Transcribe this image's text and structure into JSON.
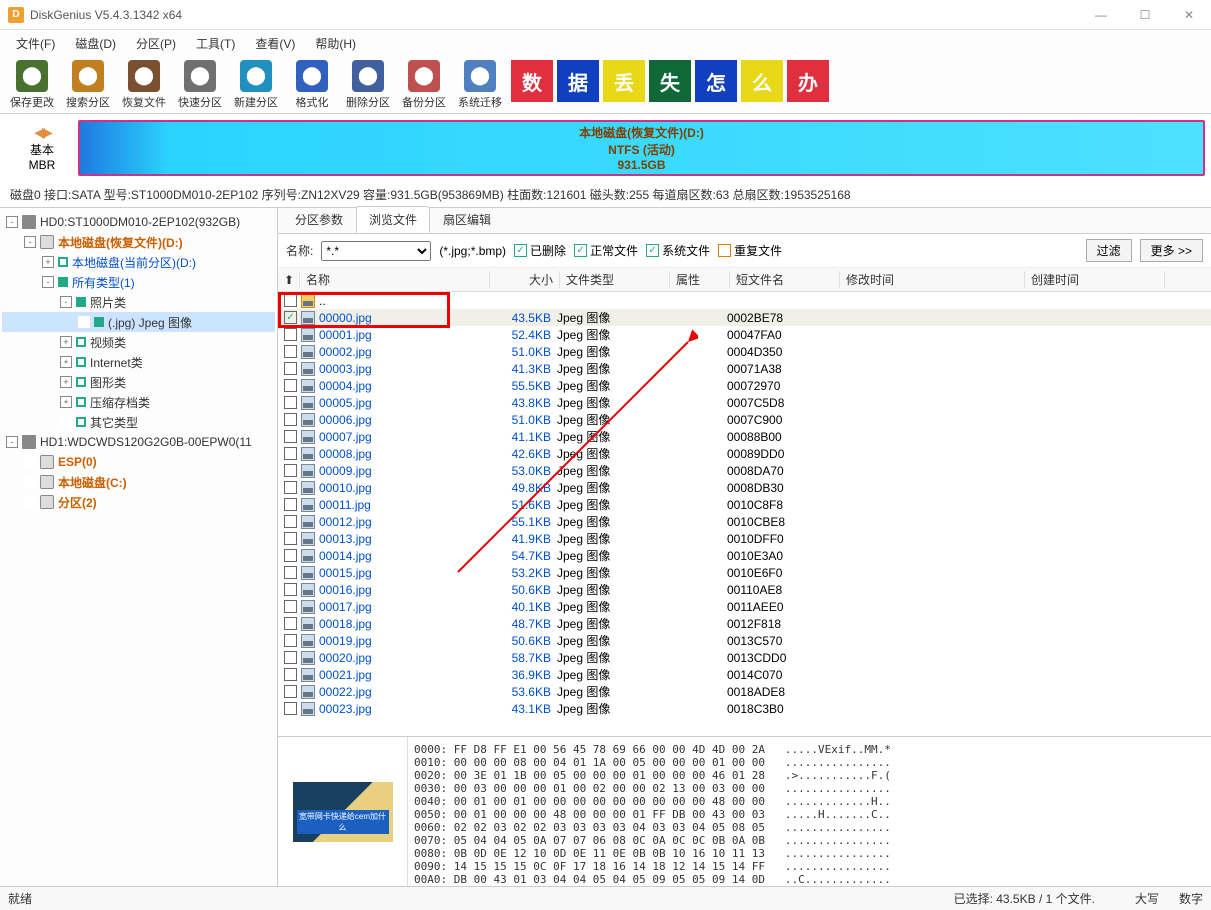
{
  "title": "DiskGenius V5.4.3.1342 x64",
  "menu": [
    "文件(F)",
    "磁盘(D)",
    "分区(P)",
    "工具(T)",
    "查看(V)",
    "帮助(H)"
  ],
  "toolbar": [
    {
      "label": "保存更改",
      "color": "#4a7030"
    },
    {
      "label": "搜索分区",
      "color": "#c08020"
    },
    {
      "label": "恢复文件",
      "color": "#7a5030"
    },
    {
      "label": "快速分区",
      "color": "#707070"
    },
    {
      "label": "新建分区",
      "color": "#2090c0"
    },
    {
      "label": "格式化",
      "color": "#3060c0"
    },
    {
      "label": "删除分区",
      "color": "#4060a0"
    },
    {
      "label": "备份分区",
      "color": "#c05050"
    },
    {
      "label": "系统迁移",
      "color": "#5080c0"
    }
  ],
  "banner": [
    {
      "t": "数",
      "c": "#e03040"
    },
    {
      "t": "据",
      "c": "#1040c0"
    },
    {
      "t": "丢",
      "c": "#e8d818"
    },
    {
      "t": "失",
      "c": "#106838"
    },
    {
      "t": "怎",
      "c": "#1040c0"
    },
    {
      "t": "么",
      "c": "#e8d818"
    },
    {
      "t": "办",
      "c": "#e03040"
    }
  ],
  "mbr_basic": "基本",
  "mbr_mbr": "MBR",
  "partition": {
    "line1": "本地磁盘(恢复文件)(D:)",
    "line2": "NTFS (活动)",
    "line3": "931.5GB"
  },
  "disk_info": "磁盘0 接口:SATA  型号:ST1000DM010-2EP102  序列号:ZN12XV29  容量:931.5GB(953869MB)  柱面数:121601  磁头数:255  每道扇区数:63  总扇区数:1953525168",
  "tree": [
    {
      "indent": 0,
      "twist": "-",
      "ico": "hdd",
      "label": "HD0:ST1000DM010-2EP102(932GB)",
      "cls": ""
    },
    {
      "indent": 1,
      "twist": "-",
      "ico": "disk",
      "label": "本地磁盘(恢复文件)(D:)",
      "cls": "orange"
    },
    {
      "indent": 2,
      "twist": "+",
      "ico": "sq-g",
      "label": "本地磁盘(当前分区)(D:)",
      "cls": "blue"
    },
    {
      "indent": 2,
      "twist": "-",
      "ico": "sq-gf",
      "label": "所有类型(1)",
      "cls": "blue"
    },
    {
      "indent": 3,
      "twist": "-",
      "ico": "sq-gf",
      "label": "照片类",
      "cls": ""
    },
    {
      "indent": 4,
      "twist": "",
      "ico": "sq-gf",
      "label": "(.jpg) Jpeg 图像",
      "cls": "",
      "sel": true
    },
    {
      "indent": 3,
      "twist": "+",
      "ico": "sq-g",
      "label": "视频类",
      "cls": ""
    },
    {
      "indent": 3,
      "twist": "+",
      "ico": "sq-g",
      "label": "Internet类",
      "cls": ""
    },
    {
      "indent": 3,
      "twist": "+",
      "ico": "sq-g",
      "label": "图形类",
      "cls": ""
    },
    {
      "indent": 3,
      "twist": "+",
      "ico": "sq-g",
      "label": "压缩存档类",
      "cls": ""
    },
    {
      "indent": 3,
      "twist": "",
      "ico": "sq-g",
      "label": "其它类型",
      "cls": ""
    },
    {
      "indent": 0,
      "twist": "-",
      "ico": "hdd",
      "label": "HD1:WDCWDS120G2G0B-00EPW0(11",
      "cls": ""
    },
    {
      "indent": 1,
      "twist": "",
      "ico": "disk",
      "label": "ESP(0)",
      "cls": "orange"
    },
    {
      "indent": 1,
      "twist": "",
      "ico": "disk",
      "label": "本地磁盘(C:)",
      "cls": "orange"
    },
    {
      "indent": 1,
      "twist": "",
      "ico": "disk",
      "label": "分区(2)",
      "cls": "orange"
    }
  ],
  "tabs": [
    "分区参数",
    "浏览文件",
    "扇区编辑"
  ],
  "active_tab": 1,
  "filter": {
    "name_label": "名称:",
    "name_value": "*.*",
    "ext_hint": "(*.jpg;*.bmp)",
    "chk_deleted": "已删除",
    "chk_normal": "正常文件",
    "chk_system": "系统文件",
    "chk_repeat": "重复文件",
    "btn_filter": "过滤",
    "btn_more": "更多 >>"
  },
  "columns": {
    "up": "⬆",
    "name": "名称",
    "size": "大小",
    "type": "文件类型",
    "attr": "属性",
    "short": "短文件名",
    "mtime": "修改时间",
    "ctime": "创建时间"
  },
  "parent_row": "..",
  "files": [
    {
      "chk": true,
      "name": "00000.jpg",
      "size": "43.5KB",
      "short": "0002BE78"
    },
    {
      "chk": false,
      "name": "00001.jpg",
      "size": "52.4KB",
      "short": "00047FA0"
    },
    {
      "chk": false,
      "name": "00002.jpg",
      "size": "51.0KB",
      "short": "0004D350"
    },
    {
      "chk": false,
      "name": "00003.jpg",
      "size": "41.3KB",
      "short": "00071A38"
    },
    {
      "chk": false,
      "name": "00004.jpg",
      "size": "55.5KB",
      "short": "00072970"
    },
    {
      "chk": false,
      "name": "00005.jpg",
      "size": "43.8KB",
      "short": "0007C5D8"
    },
    {
      "chk": false,
      "name": "00006.jpg",
      "size": "51.0KB",
      "short": "0007C900"
    },
    {
      "chk": false,
      "name": "00007.jpg",
      "size": "41.1KB",
      "short": "00088B00"
    },
    {
      "chk": false,
      "name": "00008.jpg",
      "size": "42.6KB",
      "short": "00089DD0"
    },
    {
      "chk": false,
      "name": "00009.jpg",
      "size": "53.0KB",
      "short": "0008DA70"
    },
    {
      "chk": false,
      "name": "00010.jpg",
      "size": "49.8KB",
      "short": "0008DB30"
    },
    {
      "chk": false,
      "name": "00011.jpg",
      "size": "51.6KB",
      "short": "0010C8F8"
    },
    {
      "chk": false,
      "name": "00012.jpg",
      "size": "55.1KB",
      "short": "0010CBE8"
    },
    {
      "chk": false,
      "name": "00013.jpg",
      "size": "41.9KB",
      "short": "0010DFF0"
    },
    {
      "chk": false,
      "name": "00014.jpg",
      "size": "54.7KB",
      "short": "0010E3A0"
    },
    {
      "chk": false,
      "name": "00015.jpg",
      "size": "53.2KB",
      "short": "0010E6F0"
    },
    {
      "chk": false,
      "name": "00016.jpg",
      "size": "50.6KB",
      "short": "00110AE8"
    },
    {
      "chk": false,
      "name": "00017.jpg",
      "size": "40.1KB",
      "short": "0011AEE0"
    },
    {
      "chk": false,
      "name": "00018.jpg",
      "size": "48.7KB",
      "short": "0012F818"
    },
    {
      "chk": false,
      "name": "00019.jpg",
      "size": "50.6KB",
      "short": "0013C570"
    },
    {
      "chk": false,
      "name": "00020.jpg",
      "size": "58.7KB",
      "short": "0013CDD0"
    },
    {
      "chk": false,
      "name": "00021.jpg",
      "size": "36.9KB",
      "short": "0014C070"
    },
    {
      "chk": false,
      "name": "00022.jpg",
      "size": "53.6KB",
      "short": "0018ADE8"
    },
    {
      "chk": false,
      "name": "00023.jpg",
      "size": "43.1KB",
      "short": "0018C3B0"
    }
  ],
  "file_type": "Jpeg 图像",
  "hex": "0000: FF D8 FF E1 00 56 45 78 69 66 00 00 4D 4D 00 2A   .....VExif..MM.*\n0010: 00 00 00 08 00 04 01 1A 00 05 00 00 00 01 00 00   ................\n0020: 00 3E 01 1B 00 05 00 00 00 01 00 00 00 46 01 28   .>...........F.(\n0030: 00 03 00 00 00 01 00 02 00 00 02 13 00 03 00 00   ................\n0040: 00 01 00 01 00 00 00 00 00 00 00 00 00 48 00 00   .............H..\n0050: 00 01 00 00 00 48 00 00 00 01 FF DB 00 43 00 03   .....H.......C..\n0060: 02 02 03 02 02 03 03 03 03 04 03 03 04 05 08 05   ................\n0070: 05 04 04 05 0A 07 07 06 08 0C 0A 0C 0C 0B 0A 0B   ................\n0080: 0B 0D 0E 12 10 0D 0E 11 0E 0B 0B 10 16 10 11 13   ................\n0090: 14 15 15 15 0C 0F 17 18 16 14 18 12 14 15 14 FF   ................\n00A0: DB 00 43 01 03 04 04 05 04 05 09 05 05 09 14 0D   ..C.............",
  "thumb_text": "宽带网卡快递给cem加什么",
  "status": {
    "ready": "就绪",
    "selected": "已选择: 43.5KB / 1 个文件.",
    "caps": "大写",
    "num": "数字"
  }
}
